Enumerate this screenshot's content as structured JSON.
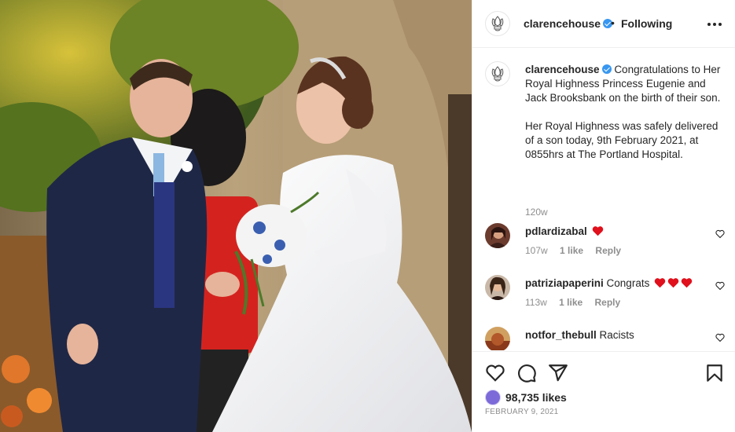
{
  "post": {
    "photo_alt": "Princess Eugenie and Jack Brooksbank wedding photo",
    "username": "clarencehouse",
    "verified": true,
    "separator": "•",
    "follow_status": "Following",
    "more_icon": "more-horizontal-icon"
  },
  "caption": {
    "username": "clarencehouse",
    "paragraph1": "Congratulations to Her Royal Highness Princess Eugenie and Jack Brooksbank on the birth of their son.",
    "paragraph2": "Her Royal Highness was safely delivered of a son today, 9th February 2021, at 0855hrs at The Portland Hospital.",
    "age": "120w"
  },
  "comments": [
    {
      "username": "pdlardizabal",
      "text": "",
      "hearts": 1,
      "age": "107w",
      "likes": "1 like",
      "reply": "Reply"
    },
    {
      "username": "patriziapaperini",
      "text": "Congrats",
      "hearts": 3,
      "age": "113w",
      "likes": "1 like",
      "reply": "Reply"
    },
    {
      "username": "notfor_thebull",
      "text": "Racists",
      "hearts": 0,
      "age": "",
      "likes": "",
      "reply": ""
    }
  ],
  "actions": {
    "like_icon": "heart-icon",
    "comment_icon": "comment-icon",
    "share_icon": "paper-plane-icon",
    "save_icon": "bookmark-icon"
  },
  "likes": {
    "count": "98,735 likes"
  },
  "date": "February 9, 2021",
  "colors": {
    "verified_blue": "#3897f0",
    "heart_red": "#ed4956",
    "text_primary": "#262626",
    "text_secondary": "#8e8e8e",
    "border": "#efefef"
  }
}
